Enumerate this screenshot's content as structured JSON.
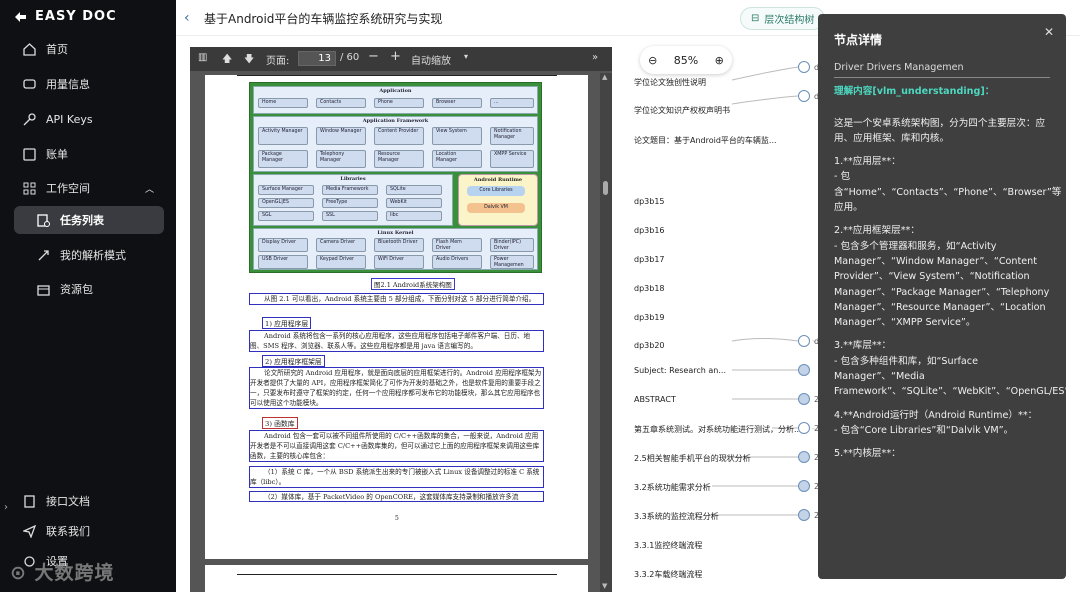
{
  "sidebar": {
    "logo": "EASY DOC",
    "items": [
      {
        "label": "首页",
        "icon": "home-icon"
      },
      {
        "label": "用量信息",
        "icon": "chat-icon"
      },
      {
        "label": "API Keys",
        "icon": "key-icon"
      },
      {
        "label": "账单",
        "icon": "bill-icon"
      },
      {
        "label": "工作空间",
        "icon": "grid-icon"
      },
      {
        "label": "任务列表",
        "icon": "task-icon"
      },
      {
        "label": "我的解析模式",
        "icon": "puzzle-icon"
      },
      {
        "label": "资源包",
        "icon": "package-icon"
      }
    ],
    "bottom": [
      {
        "label": "接口文档",
        "icon": "doc-icon"
      },
      {
        "label": "联系我们",
        "icon": "send-icon"
      },
      {
        "label": "设置",
        "icon": "settings-icon"
      }
    ],
    "watermark": "大数跨境"
  },
  "header": {
    "title": "基于Android平台的车辆监控系统研究与实现",
    "view_tab": "层次结构树"
  },
  "pdf": {
    "page_label": "页面:",
    "page_current": "13",
    "page_total": "/ 60",
    "zoom": "自动缩放",
    "page_number": "5",
    "diagram": {
      "application": "Application",
      "apps": [
        "Home",
        "Contacts",
        "Phone",
        "Browser",
        "..."
      ],
      "framework": "Application Framework",
      "fw": [
        "Activity Manager",
        "Window Manager",
        "Content Provider",
        "View System",
        "Notification Manager",
        "Package Manager",
        "Telephony Manager",
        "Resource Manager",
        "Location Manager",
        "XMPP Service"
      ],
      "libraries": "Libraries",
      "libs": [
        "Surface Manager",
        "Media Framework",
        "SQLite",
        "OpenGL|ES",
        "FreeType",
        "WebKit",
        "SGL",
        "SSL",
        "libc"
      ],
      "runtime": "Android Runtime",
      "rt": [
        "Core Libraries",
        "Dalvik VM"
      ],
      "kernel": "Linux Kernel",
      "kn": [
        "Display Driver",
        "Camera Driver",
        "Bluetooth Driver",
        "Flash Mem Driver",
        "Binder(IPC) Driver",
        "USB Driver",
        "Keypad Driver",
        "WiFi Driver",
        "Audio Drivers",
        "Power Managemen"
      ]
    },
    "caption": "图2.1 Android系统架构图",
    "paras": [
      "从图 2.1 可以看出，Android 系统主要由 5 部分组成，下面分别对这 5 部分进行简单介绍。",
      "1) 应用程序层",
      "Android 系统将包含一系列的核心应用程序，这些应用程序包括电子邮件客户端、日历、地图、SMS 程序、浏览器、联系人等。这些应用程序都是用 java 语言编写的。",
      "2) 应用程序框架层",
      "论文所研究的 Android 应用程序，就是面向底层的应用框架进行的。Android 应用程序框架为开发者提供了大量的 API，应用程序框架简化了可作为开发的基础之外，也是软件复用的重要手段之一，只要发布时遵守了框架的约定，任何一个应用程序都可发布它的功能模块，那么其它应用程序也可以使用这个功能模块。",
      "3) 函数库",
      "Android 包含一套可以被不同组件所使用的 C/C++函数库的集合，一般来说，Android 应用开发者是不可以直接调用这套 C/C++函数库集的，但可以通过它上面的应用程序框架来调用这些库函数，主要的核心库包含：",
      "（1）系统 C 库，一个从 BSD 系统派生出来的专门被嵌入式 Linux 设备调整过的标准 C 系统库（libc）。",
      "（2）媒体库，基于 PacketVideo 的 OpenCORE，这套媒体库支持录制和播放许多流"
    ]
  },
  "mindmap": {
    "zoom": "85%",
    "nodes": [
      "学位论文独创性说明",
      "学位论文知识产权权声明书",
      "论文题目：基于Android平台的车辆监...",
      "dp3b15",
      "dp3b16",
      "dp3b17",
      "dp3b18",
      "dp3b19",
      "dp3b20",
      "Subject: Research an...",
      "ABSTRACT",
      "第五章系统测试。对系统功能进行测试，分析...",
      "2.5相关智能手机平台的现状分析",
      "3.2系统功能需求分析",
      "3.3系统的监控流程分析",
      "3.3.1监控终端流程",
      "3.3.2车载终端流程"
    ],
    "right_labels": [
      "d",
      "d",
      "d",
      "2",
      "2",
      "2",
      "2",
      "2"
    ]
  },
  "detail": {
    "title": "节点详情",
    "prev": "Driver Drivers Managemen",
    "tag": "理解内容[vlm_understanding]：",
    "lines": [
      "这是一个安卓系统架构图，分为四个主要层次：应用、应用框架、库和内核。",
      "1.**应用层**：",
      "- 包含“Home”、“Contacts”、“Phone”、“Browser”等应用。",
      "2.**应用框架层**：",
      "- 包含多个管理器和服务，如“Activity Manager”、“Window Manager”、“Content Provider”、“View System”、“Notification Manager”、“Package Manager”、“Telephony Manager”、“Resource Manager”、“Location Manager”、“XMPP Service”。",
      "3.**库层**：",
      "- 包含多种组件和库，如“Surface Manager”、“Media Framework”、“SQLite”、“WebKit”、“OpenGL/ES”、“FreeType”、“libc”、“SGL”、“SSL”。",
      "4.**Android运行时（Android Runtime）**：",
      "- 包含“Core Libraries”和“Dalvik VM”。",
      "5.**内核层**："
    ]
  }
}
